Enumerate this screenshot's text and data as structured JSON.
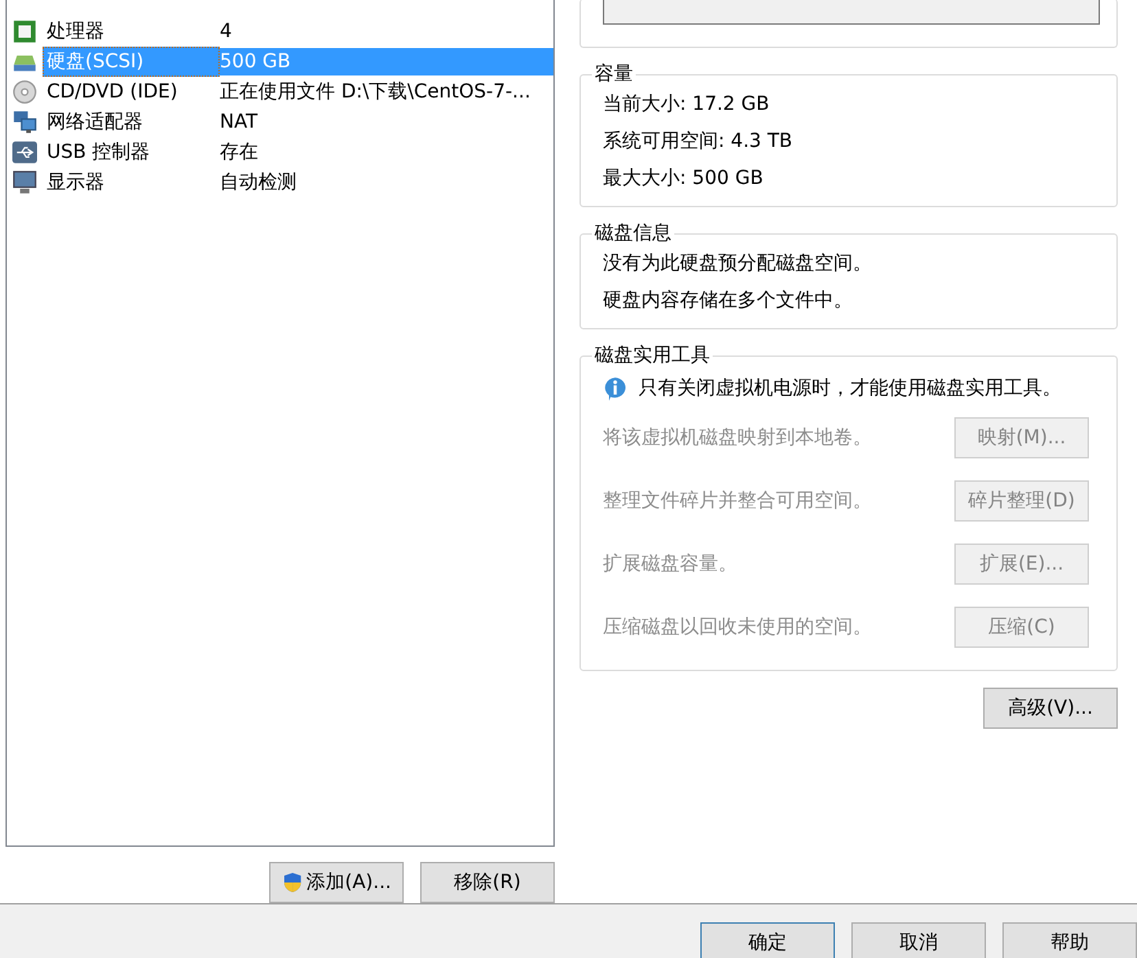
{
  "devices": [
    {
      "kind": "cpu",
      "name": "处理器",
      "summary": "4",
      "selected": false
    },
    {
      "kind": "disk",
      "name": "硬盘(SCSI)",
      "summary": "500 GB",
      "selected": true
    },
    {
      "kind": "cdrom",
      "name": "CD/DVD (IDE)",
      "summary": "正在使用文件 D:\\下载\\CentOS-7-...",
      "selected": false
    },
    {
      "kind": "network",
      "name": "网络适配器",
      "summary": "NAT",
      "selected": false
    },
    {
      "kind": "usb",
      "name": "USB 控制器",
      "summary": "存在",
      "selected": false
    },
    {
      "kind": "display",
      "name": "显示器",
      "summary": "自动检测",
      "selected": false
    }
  ],
  "list_buttons": [
    {
      "label": "添加(A)...",
      "shield": true
    },
    {
      "label": "移除(R)",
      "shield": false
    }
  ],
  "capacity": {
    "title": "容量",
    "lines": [
      "当前大小: 17.2 GB",
      "系统可用空间: 4.3 TB",
      "最大大小: 500 GB"
    ]
  },
  "disk_info": {
    "title": "磁盘信息",
    "lines": [
      "没有为此硬盘预分配磁盘空间。",
      "硬盘内容存储在多个文件中。"
    ]
  },
  "utilities": {
    "title": "磁盘实用工具",
    "notice": "只有关闭虚拟机电源时，才能使用磁盘实用工具。",
    "actions": [
      {
        "description": "将该虚拟机磁盘映射到本地卷。",
        "button": "映射(M)...",
        "disabled": true
      },
      {
        "description": "整理文件碎片并整合可用空间。",
        "button": "碎片整理(D)",
        "disabled": true
      },
      {
        "description": "扩展磁盘容量。",
        "button": "扩展(E)...",
        "disabled": true
      },
      {
        "description": "压缩磁盘以回收未使用的空间。",
        "button": "压缩(C)",
        "disabled": true
      }
    ]
  },
  "advanced_button": "高级(V)...",
  "dialog_buttons": [
    {
      "label": "确定",
      "default": true
    },
    {
      "label": "取消",
      "default": false
    },
    {
      "label": "帮助",
      "default": false
    }
  ]
}
